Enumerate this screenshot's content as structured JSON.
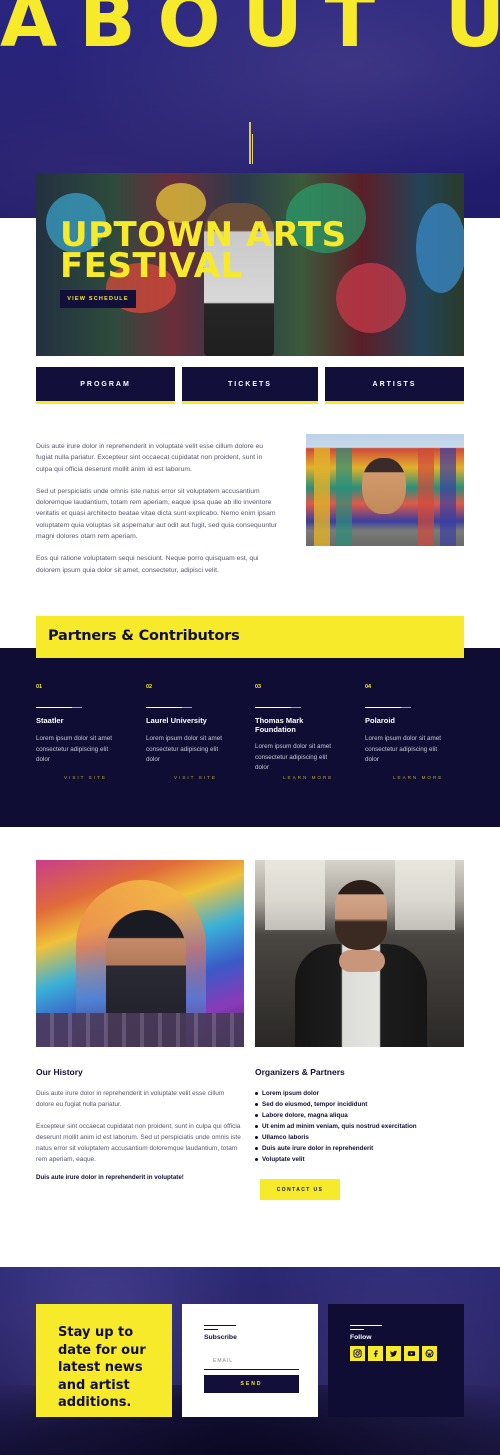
{
  "hero": {
    "title": "ABOUT US"
  },
  "feature": {
    "title": "UPTOWN ARTS FESTIVAL",
    "button": "VIEW SCHEDULE"
  },
  "nav": [
    {
      "label": "PROGRAM"
    },
    {
      "label": "TICKETS"
    },
    {
      "label": "ARTISTS"
    }
  ],
  "intro": {
    "paragraphs": [
      "Duis aute irure dolor in reprehenderit in voluptate velit esse cillum dolore eu fugiat nulla pariatur. Excepteur sint occaecat cupidatat non proident, sunt in culpa qui officia deserunt mollit anim id est laborum.",
      "Sed ut perspiciatis unde omnis iste natus error sit voluptatem accusantium doloremque laudantium, totam rem aperiam, eaque ipsa quae ab illo inventore veritatis et quasi architecto beatae vitae dicta sunt explicabo. Nemo enim ipsam voluptatem quia voluptas sit aspernatur aut odit aut fugit, sed quia consequuntur magni dolores otam rem aperiam.",
      "Eos qui ratione voluptatem sequi nesciunt. Neque porro quisquam est, qui dolorem ipsum quia dolor sit amet, consectetur, adipisci velit."
    ]
  },
  "partners": {
    "heading": "Partners & Contributors",
    "items": [
      {
        "num": "01",
        "name": "Staatler",
        "desc": "Lorem ipsum dolor sit amet consectetur adipiscing elit dolor",
        "link": "VISIT SITE"
      },
      {
        "num": "02",
        "name": "Laurel University",
        "desc": "Lorem ipsum dolor sit amet consectetur adipiscing elit dolor",
        "link": "VISIT SITE"
      },
      {
        "num": "03",
        "name": "Thomas Mark Foundation",
        "desc": "Lorem ipsum dolor sit amet consectetur adipiscing elit dolor",
        "link": "LEARN MORE"
      },
      {
        "num": "04",
        "name": "Polaroid",
        "desc": "Lorem ipsum dolor sit amet consectetur adipiscing elit dolor",
        "link": "LEARN MORE"
      }
    ]
  },
  "history": {
    "heading": "Our History",
    "paragraphs": [
      "Duis aute irure dolor in reprehenderit in voluptate velit esse cillum dolore eu fugiat nulla pariatur.",
      "Excepteur sint occaecat cupidatat non proident, sunt in culpa qui officia deserunt mollit anim id est laborum. Sed ut perspiciatis unde omnis iste natus error sit voluptatem accusantium doloremque laudantium, totam rem aperiam, eaque."
    ],
    "bold": "Duis aute irure dolor in reprehenderit in voluptate!"
  },
  "organizers": {
    "heading": "Organizers & Partners",
    "items": [
      "Lorem ipsum dolor",
      "Sed do eiusmod, tempor incididunt",
      "Labore dolore, magna aliqua",
      "Ut enim ad minim veniam, quis nostrud exercitation",
      "Ullamco laboris",
      "Duis aute irure dolor in reprehenderit",
      "Voluptate velit"
    ],
    "button": "CONTACT US"
  },
  "footer": {
    "news": "Stay up to date for our latest news and artist additions.",
    "subscribe": {
      "title": "Subscribe",
      "placeholder": "EMAIL",
      "button": "SEND"
    },
    "follow": {
      "title": "Follow",
      "icons": [
        "instagram-icon",
        "facebook-icon",
        "twitter-icon",
        "youtube-icon",
        "wordpress-icon"
      ]
    }
  },
  "colors": {
    "accent": "#f7ea2a",
    "navy": "#12103a",
    "hero": "#241f74"
  }
}
